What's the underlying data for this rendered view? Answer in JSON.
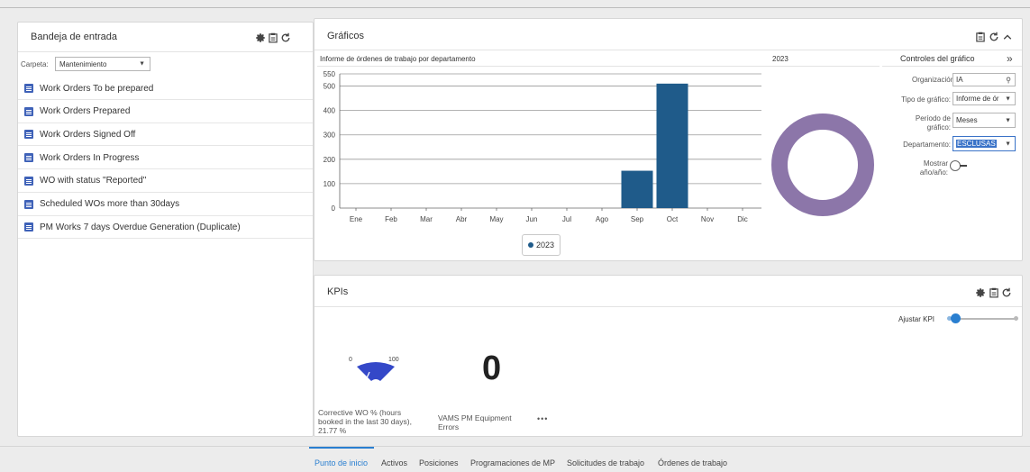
{
  "inbox": {
    "title": "Bandeja de entrada",
    "folder_label": "Carpeta:",
    "folder_value": "Mantenimiento",
    "items": [
      {
        "label": "Work Orders To be prepared"
      },
      {
        "label": "Work Orders Prepared"
      },
      {
        "label": "Work Orders Signed Off"
      },
      {
        "label": "Work Orders In Progress"
      },
      {
        "label": "WO with status \"Reported\""
      },
      {
        "label": "Scheduled WOs more than 30days"
      },
      {
        "label": "PM Works 7 days Overdue Generation (Duplicate)"
      }
    ]
  },
  "graficos": {
    "title": "Gráficos",
    "chart_subtitle": "Informe de órdenes de trabajo por departamento",
    "donut_subtitle": "2023",
    "controls": {
      "title": "Controles del gráfico",
      "collapse_icon": "double-chevron-right",
      "organizacion_label": "Organización:",
      "organizacion_value": "IA",
      "tipo_label": "Tipo de gráfico:",
      "tipo_value": "Informe de ór",
      "periodo_label": "Período de gráfico:",
      "periodo_value": "Meses",
      "departamento_label": "Departamento:",
      "departamento_value": "ESCLUSAS",
      "mostrar_label": "Mostrar año/año:"
    },
    "legend": "2023"
  },
  "chart_data": [
    {
      "type": "bar",
      "title": "Informe de órdenes de trabajo por departamento",
      "categories": [
        "Ene",
        "Feb",
        "Mar",
        "Abr",
        "May",
        "Jun",
        "Jul",
        "Ago",
        "Sep",
        "Oct",
        "Nov",
        "Dic"
      ],
      "series": [
        {
          "name": "2023",
          "values": [
            0,
            0,
            0,
            0,
            0,
            0,
            0,
            0,
            153,
            510,
            0,
            0
          ]
        }
      ],
      "yticks": [
        0,
        100,
        200,
        300,
        400,
        500,
        550
      ],
      "ylim": [
        0,
        550
      ],
      "grid": true,
      "colors": {
        "bar": "#1f5b8a"
      }
    },
    {
      "type": "pie",
      "title": "2023",
      "labels": [
        "ESCLUSAS"
      ],
      "values": [
        663
      ],
      "colors": {
        "slice": "#8c76a9"
      }
    }
  ],
  "kpis": {
    "title": "KPIs",
    "slider_label": "Ajustar KPI",
    "slider_value": 0.1,
    "gauge_min": "0",
    "gauge_max": "100",
    "gauge_value": 21.77,
    "gauge_caption": [
      "Corrective WO % (hours",
      "booked in the last 30 days),",
      "21.77 %"
    ],
    "big_value": "0",
    "big_caption": [
      "VAMS PM Equipment",
      "Errors"
    ],
    "more": "•••"
  },
  "bottom_nav": [
    {
      "label": "Punto de inicio",
      "active": true
    },
    {
      "label": "Activos"
    },
    {
      "label": "Posiciones"
    },
    {
      "label": "Programaciones de MP"
    },
    {
      "label": "Solicitudes de trabajo"
    },
    {
      "label": "Órdenes de trabajo"
    }
  ]
}
